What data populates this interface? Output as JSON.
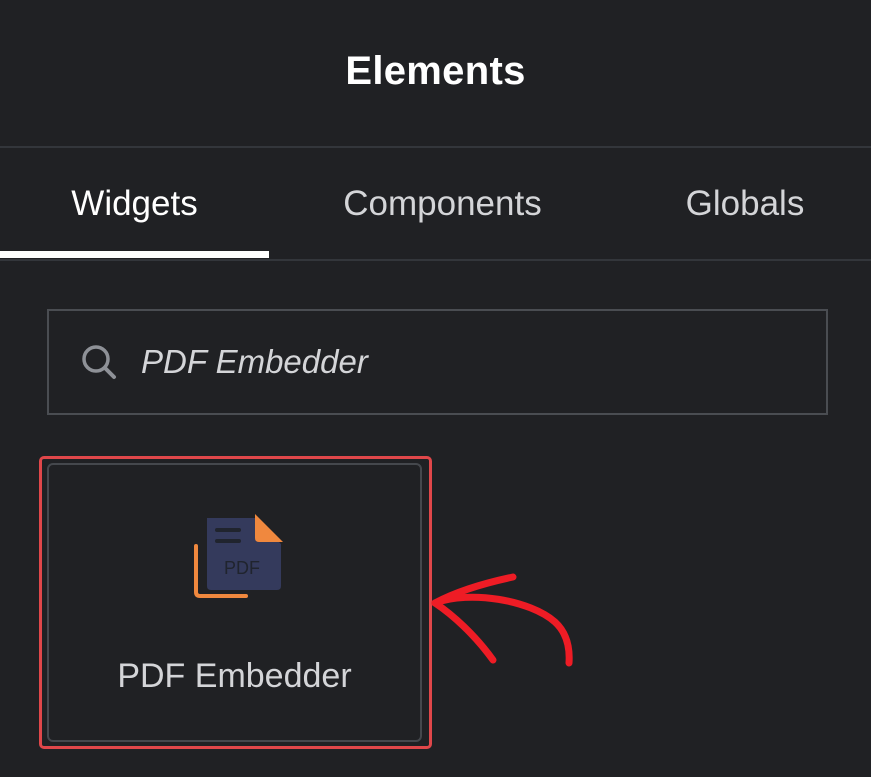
{
  "panel": {
    "title": "Elements"
  },
  "tabs": [
    {
      "label": "Widgets",
      "active": true
    },
    {
      "label": "Components",
      "active": false
    },
    {
      "label": "Globals",
      "active": false
    }
  ],
  "search": {
    "value": "PDF Embedder",
    "icon": "search-icon"
  },
  "results": [
    {
      "label": "PDF Embedder",
      "icon": "pdf-embedder-icon",
      "icon_text": "PDF"
    }
  ],
  "annotation": {
    "highlight_color": "#e0474a",
    "arrow_color": "#ee1c25"
  },
  "colors": {
    "background": "#202124",
    "text": "#d4d5d8",
    "active_text": "#ffffff",
    "icon_doc": "#343a5c",
    "icon_accent": "#f0883e"
  }
}
